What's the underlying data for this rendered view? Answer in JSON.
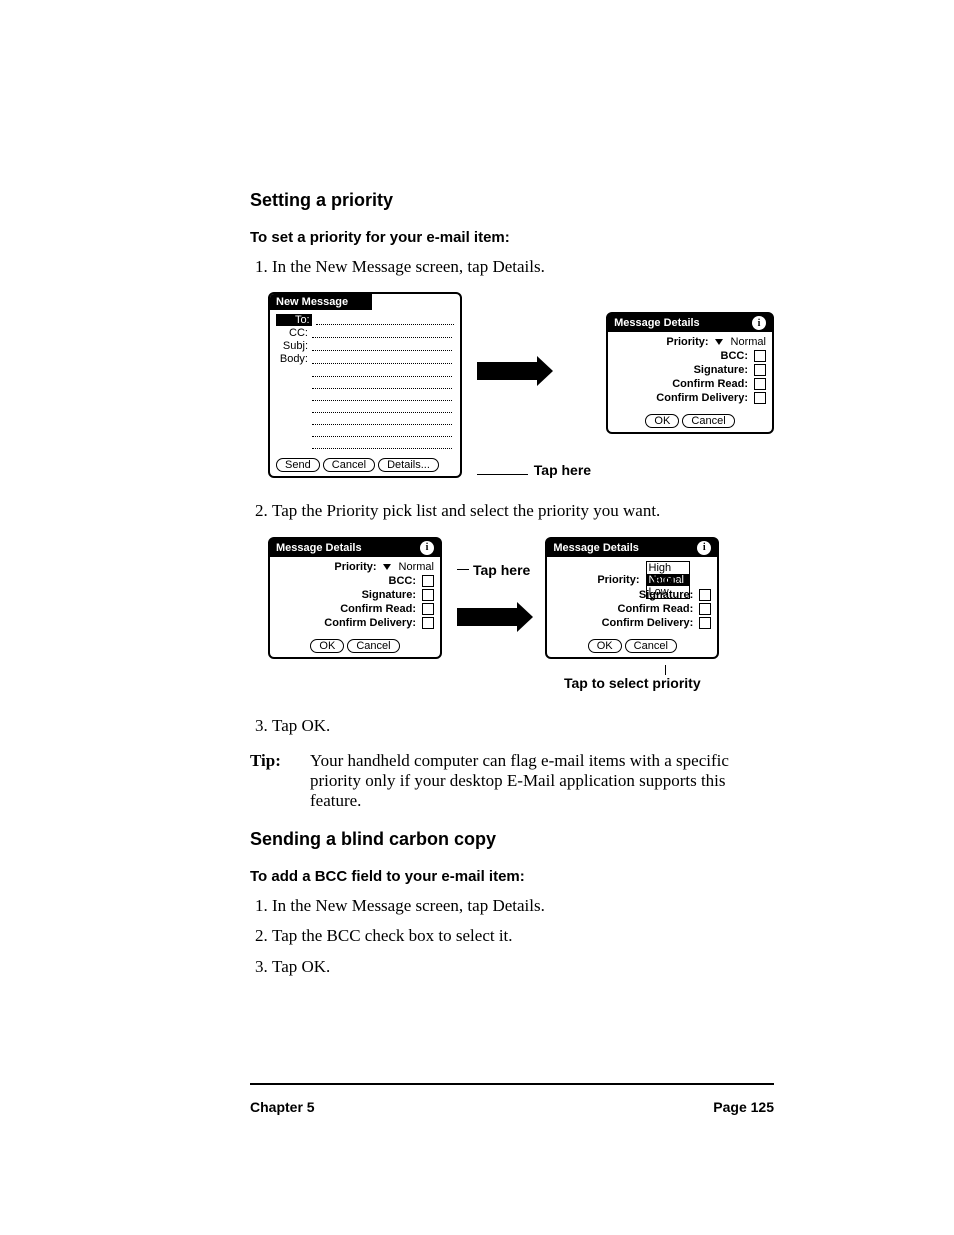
{
  "section1": {
    "heading": "Setting a priority",
    "subheading": "To set a priority for your e-mail item:",
    "step1": "In the New Message screen, tap Details.",
    "step2": "Tap the Priority pick list and select the priority you want.",
    "step3": "Tap OK."
  },
  "tip": {
    "label": "Tip:",
    "text": "Your handheld computer can flag e-mail items with a specific priority only if your desktop E-Mail application supports this feature."
  },
  "section2": {
    "heading": "Sending a blind carbon copy",
    "subheading": "To add a BCC field to your e-mail item:",
    "step1": "In the New Message screen, tap Details.",
    "step2": "Tap the BCC check box to select it.",
    "step3": "Tap OK."
  },
  "newmsg": {
    "title": "New Message",
    "to": "To:",
    "cc": "CC:",
    "subj": "Subj:",
    "body": "Body:",
    "send": "Send",
    "cancel": "Cancel",
    "details": "Details..."
  },
  "details": {
    "title": "Message Details",
    "priority_label": "Priority:",
    "priority_value": "Normal",
    "bcc_label": "BCC:",
    "sig_label": "Signature:",
    "cread_label": "Confirm Read:",
    "cdel_label": "Confirm Delivery:",
    "ok": "OK",
    "cancel": "Cancel"
  },
  "priority_options": {
    "high": "High",
    "normal": "Normal",
    "low": "Low"
  },
  "callouts": {
    "tap_here": "Tap here",
    "tap_select": "Tap to select priority"
  },
  "footer": {
    "chapter": "Chapter 5",
    "page": "Page 125"
  }
}
